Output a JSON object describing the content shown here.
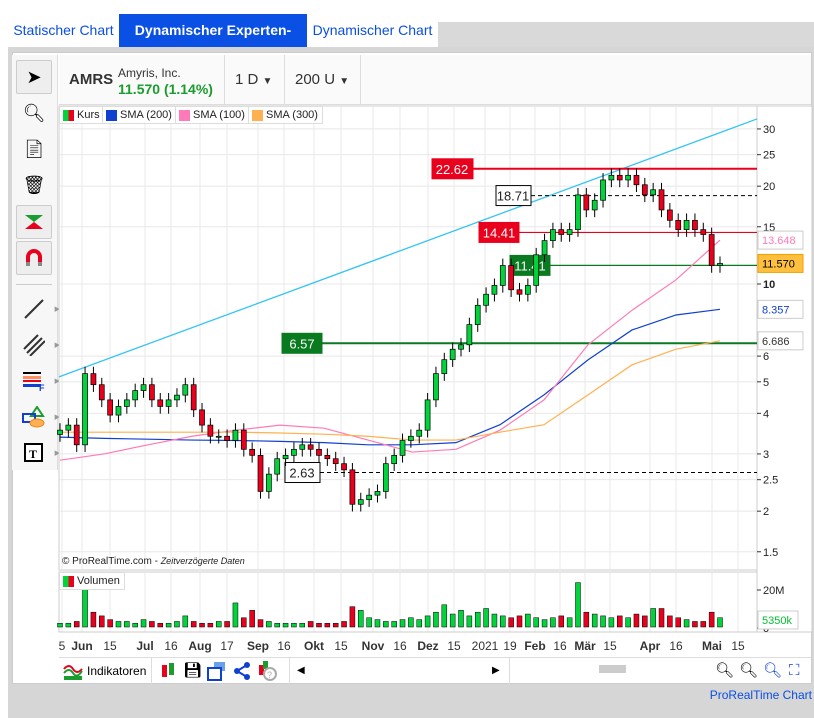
{
  "tabs": [
    {
      "label": "Statischer Chart"
    },
    {
      "label": "Dynamischer Experten-Chart",
      "active": true
    },
    {
      "label": "Dynamischer Chart"
    }
  ],
  "header": {
    "symbol": "AMRS",
    "company": "Amyris, Inc.",
    "price": "11.570 (1.14%)",
    "interval": "1 D",
    "range": "200 U"
  },
  "legend": [
    {
      "label": "Kurs"
    },
    {
      "label": "SMA (200)",
      "color": "#1040d0"
    },
    {
      "label": "SMA (100)",
      "color": "#ff7ab8"
    },
    {
      "label": "SMA (300)",
      "color": "#ffb050"
    }
  ],
  "volume_legend": "Volumen",
  "credit": "© ProRealTime.com",
  "credit_note": "Zeitverzögerte Daten",
  "toolbar_bottom": {
    "indicators": "Indikatoren"
  },
  "footer_link": "ProRealTime Chart",
  "left_tools": [
    "cursor-icon",
    "zoom-icon",
    "copy-icon",
    "trash-icon",
    "color-icon",
    "magnet-icon",
    "line-icon",
    "parallel-lines-icon",
    "fibonacci-icon",
    "shapes-icon",
    "text-icon"
  ],
  "colors": {
    "up": "#00d43a",
    "down": "#e8001c",
    "accent": "#0a50e4",
    "price_green": "#1a9c2e"
  },
  "chart_data": {
    "type": "candlestick",
    "y_scale": "log",
    "y_ticks": [
      1.5,
      2,
      2.5,
      3,
      4,
      5,
      6,
      10,
      15,
      20,
      25,
      30
    ],
    "x_ticks": [
      "5",
      "Jun",
      "15",
      "Jul",
      "16",
      "Aug",
      "17",
      "Sep",
      "16",
      "Okt",
      "15",
      "Nov",
      "16",
      "Dez",
      "15",
      "2021",
      "19",
      "Feb",
      "16",
      "Mär",
      "15",
      "Apr",
      "16",
      "Mai",
      "15"
    ],
    "closes": [
      3.55,
      3.68,
      3.2,
      5.3,
      4.9,
      4.4,
      3.95,
      4.2,
      4.4,
      4.7,
      4.9,
      4.4,
      4.2,
      4.4,
      4.55,
      4.9,
      4.1,
      3.68,
      3.4,
      3.4,
      3.3,
      3.55,
      3.1,
      2.97,
      2.3,
      2.6,
      2.9,
      2.97,
      3.1,
      3.2,
      3.1,
      2.97,
      2.9,
      2.8,
      2.68,
      2.1,
      2.17,
      2.24,
      2.3,
      2.8,
      2.97,
      3.3,
      3.4,
      3.55,
      4.4,
      5.3,
      5.85,
      6.3,
      6.5,
      7.5,
      8.6,
      9.3,
      9.9,
      11.4,
      9.6,
      9.3,
      9.9,
      12.3,
      13.6,
      14.7,
      14.2,
      14.7,
      18.8,
      16.9,
      18.1,
      20.9,
      21.6,
      20.9,
      21.6,
      20.2,
      18.8,
      19.5,
      16.9,
      15.7,
      14.7,
      15.7,
      14.7,
      14.2,
      11.4,
      11.57
    ],
    "volume_millions": [
      2,
      2,
      3,
      23,
      8,
      6,
      4,
      3,
      3,
      2,
      4,
      3,
      2,
      2,
      3,
      6,
      3,
      2,
      2,
      3,
      3,
      13,
      5,
      9,
      4,
      3,
      2,
      2,
      2,
      2,
      3,
      2,
      2,
      2,
      3,
      11,
      9,
      5,
      4,
      3,
      3,
      4,
      5,
      4,
      6,
      8,
      12,
      7,
      9,
      6,
      8,
      10,
      7,
      6,
      5,
      6,
      7,
      5,
      4,
      5,
      6,
      5,
      24,
      8,
      7,
      6,
      5,
      6,
      5,
      7,
      6,
      10,
      10,
      6,
      5,
      4,
      3,
      3,
      8,
      5
    ],
    "series": [
      {
        "name": "SMA (200)",
        "color": "#1040d0",
        "values": [
          3.38,
          3.35,
          3.33,
          3.31,
          3.3,
          3.28,
          3.25,
          3.2,
          3.2,
          3.25,
          3.69,
          4.56,
          5.84,
          7.22,
          8.03,
          8.357
        ]
      },
      {
        "name": "SMA (100)",
        "color": "#ff7ab8",
        "values": [
          2.87,
          3.0,
          3.2,
          3.4,
          3.55,
          3.68,
          3.6,
          3.31,
          3.04,
          3.1,
          3.55,
          4.4,
          6.5,
          8.3,
          10.3,
          13.648
        ]
      },
      {
        "name": "SMA (300)",
        "color": "#ffb050",
        "values": [
          3.5,
          3.5,
          3.5,
          3.5,
          3.5,
          3.48,
          3.45,
          3.4,
          3.31,
          3.31,
          3.5,
          3.69,
          4.56,
          5.64,
          6.3,
          6.686
        ]
      }
    ],
    "horizontal_levels": [
      {
        "value": 22.62,
        "label": "22.62",
        "style": "red"
      },
      {
        "value": 18.71,
        "label": "18.71",
        "style": "dashed"
      },
      {
        "value": 14.41,
        "label": "14.41",
        "style": "red"
      },
      {
        "value": 11.41,
        "label": "11.41",
        "style": "green"
      },
      {
        "value": 6.57,
        "label": "6.57",
        "style": "green"
      },
      {
        "value": 2.63,
        "label": "2.63",
        "style": "dashed"
      }
    ],
    "trendline": {
      "start": 5.18,
      "end": 32.2,
      "color": "#33c4f5"
    },
    "last_values": {
      "price": "11.570",
      "sma100": "13.648",
      "sma200": "8.357",
      "sma300": "6.686",
      "volume": "5350k"
    },
    "volume_ticks": [
      "20M",
      "0"
    ]
  }
}
